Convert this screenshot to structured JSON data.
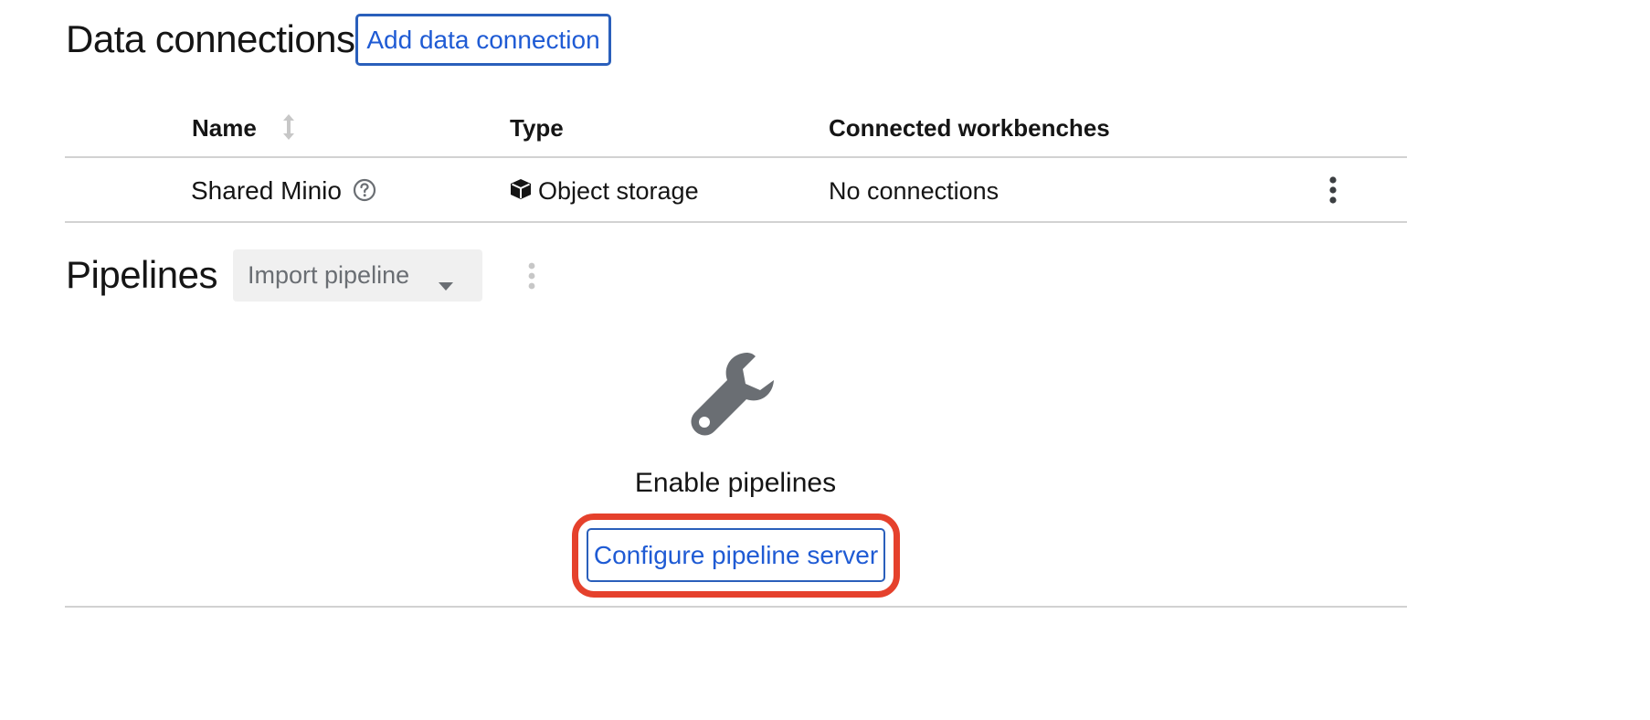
{
  "data_connections": {
    "title": "Data connections",
    "add_button_label": "Add data connection",
    "table": {
      "columns": [
        "Name",
        "Type",
        "Connected workbenches"
      ],
      "rows": [
        {
          "name": "Shared Minio",
          "type": "Object storage",
          "connected_workbenches": "No connections"
        }
      ]
    }
  },
  "pipelines": {
    "title": "Pipelines",
    "import_dropdown_label": "Import pipeline",
    "empty_state": {
      "icon": "wrench-icon",
      "title": "Enable pipelines",
      "button_label": "Configure pipeline server"
    }
  },
  "colors": {
    "link_blue": "#1f5bd4",
    "highlight_red": "#e5412c",
    "icon_gray": "#6a6e73"
  }
}
